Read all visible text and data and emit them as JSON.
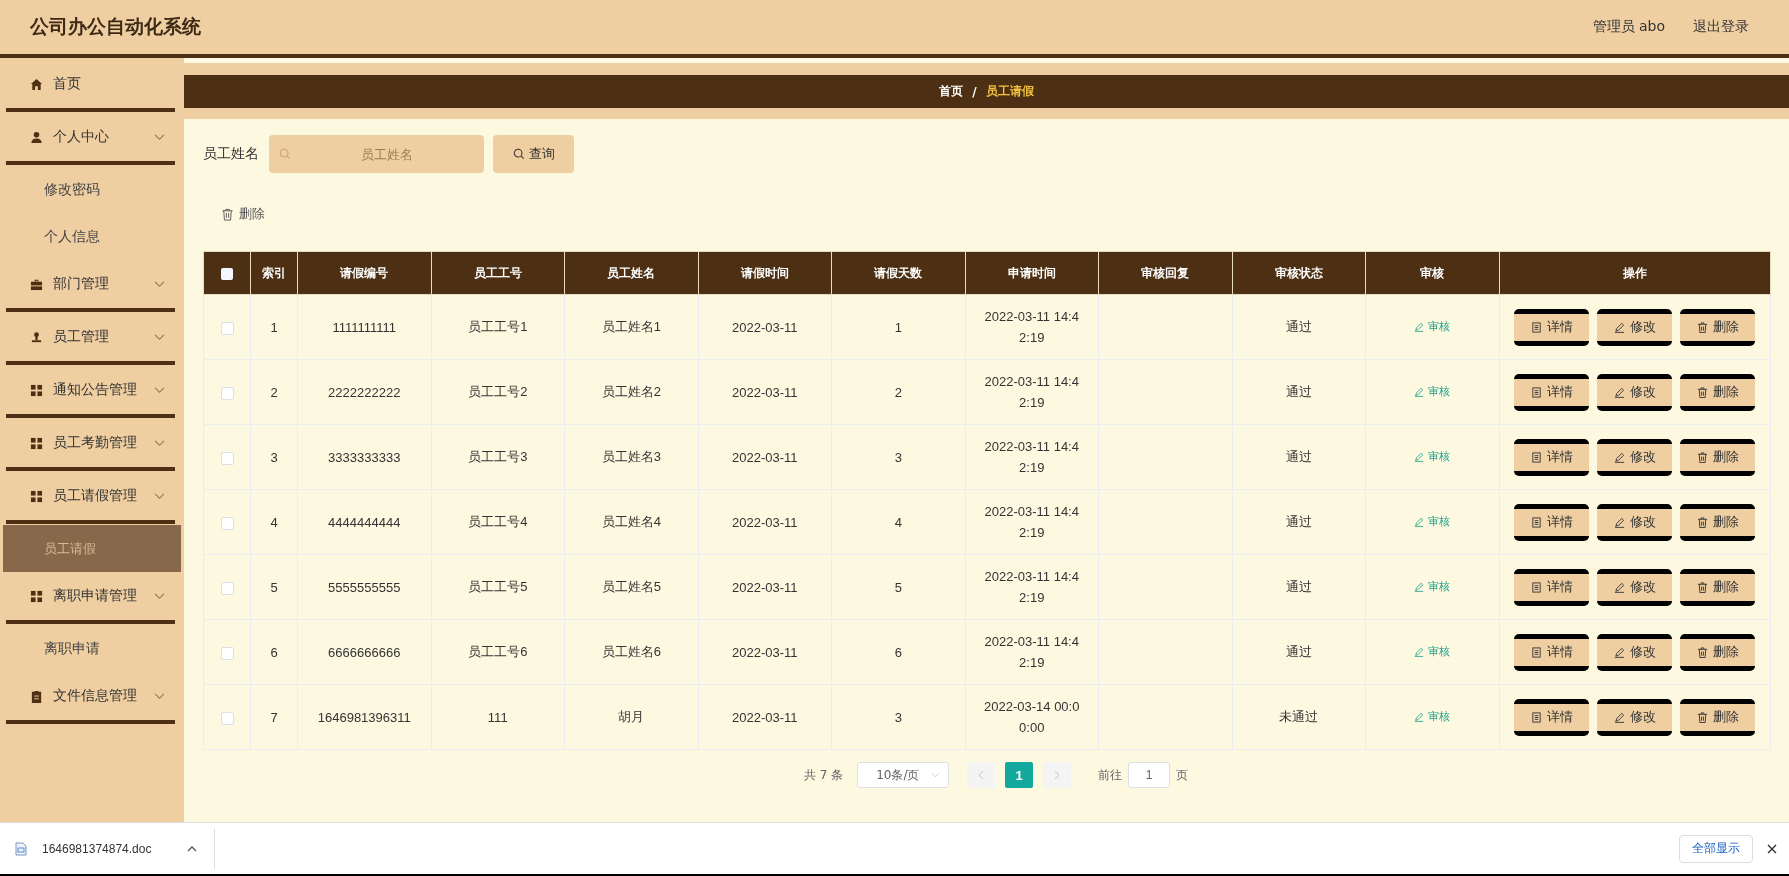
{
  "header": {
    "title": "公司办公自动化系统",
    "user": "管理员 abo",
    "logout": "退出登录"
  },
  "sidebar": {
    "items": [
      {
        "label": "首页",
        "expandable": false
      },
      {
        "label": "个人中心",
        "expandable": true,
        "children": [
          {
            "label": "修改密码",
            "selected": false
          },
          {
            "label": "个人信息",
            "selected": false
          }
        ]
      },
      {
        "label": "部门管理",
        "expandable": true
      },
      {
        "label": "员工管理",
        "expandable": true
      },
      {
        "label": "通知公告管理",
        "expandable": true
      },
      {
        "label": "员工考勤管理",
        "expandable": true
      },
      {
        "label": "员工请假管理",
        "expandable": true,
        "children": [
          {
            "label": "员工请假",
            "selected": true
          }
        ]
      },
      {
        "label": "离职申请管理",
        "expandable": true,
        "children": [
          {
            "label": "离职申请",
            "selected": false
          }
        ]
      },
      {
        "label": "文件信息管理",
        "expandable": true
      }
    ]
  },
  "breadcrumb": {
    "home": "首页",
    "separator": "/",
    "current": "员工请假"
  },
  "search": {
    "label": "员工姓名",
    "placeholder": "员工姓名",
    "button": "查询"
  },
  "delete_button": "删除",
  "table": {
    "select_all": {
      "checked": false
    },
    "columns": [
      "索引",
      "请假编号",
      "员工工号",
      "员工姓名",
      "请假时间",
      "请假天数",
      "申请时间",
      "审核回复",
      "审核状态",
      "审核",
      "操作"
    ],
    "rows": [
      {
        "checked": false,
        "index": "1",
        "leave_no": "1111111111",
        "staff_no": "员工工号1",
        "name": "员工姓名1",
        "leave_date": "2022-03-11",
        "days": "1",
        "apply_time": "2022-03-11 14:42:19",
        "reply": "",
        "status": "通过",
        "review": "审核",
        "actions": [
          "详情",
          "修改",
          "删除"
        ]
      },
      {
        "checked": false,
        "index": "2",
        "leave_no": "2222222222",
        "staff_no": "员工工号2",
        "name": "员工姓名2",
        "leave_date": "2022-03-11",
        "days": "2",
        "apply_time": "2022-03-11 14:42:19",
        "reply": "",
        "status": "通过",
        "review": "审核",
        "actions": [
          "详情",
          "修改",
          "删除"
        ]
      },
      {
        "checked": false,
        "index": "3",
        "leave_no": "3333333333",
        "staff_no": "员工工号3",
        "name": "员工姓名3",
        "leave_date": "2022-03-11",
        "days": "3",
        "apply_time": "2022-03-11 14:42:19",
        "reply": "",
        "status": "通过",
        "review": "审核",
        "actions": [
          "详情",
          "修改",
          "删除"
        ]
      },
      {
        "checked": false,
        "index": "4",
        "leave_no": "4444444444",
        "staff_no": "员工工号4",
        "name": "员工姓名4",
        "leave_date": "2022-03-11",
        "days": "4",
        "apply_time": "2022-03-11 14:42:19",
        "reply": "",
        "status": "通过",
        "review": "审核",
        "actions": [
          "详情",
          "修改",
          "删除"
        ]
      },
      {
        "checked": false,
        "index": "5",
        "leave_no": "5555555555",
        "staff_no": "员工工号5",
        "name": "员工姓名5",
        "leave_date": "2022-03-11",
        "days": "5",
        "apply_time": "2022-03-11 14:42:19",
        "reply": "",
        "status": "通过",
        "review": "审核",
        "actions": [
          "详情",
          "修改",
          "删除"
        ]
      },
      {
        "checked": false,
        "index": "6",
        "leave_no": "6666666666",
        "staff_no": "员工工号6",
        "name": "员工姓名6",
        "leave_date": "2022-03-11",
        "days": "6",
        "apply_time": "2022-03-11 14:42:19",
        "reply": "",
        "status": "通过",
        "review": "审核",
        "actions": [
          "详情",
          "修改",
          "删除"
        ]
      },
      {
        "checked": false,
        "index": "7",
        "leave_no": "1646981396311",
        "staff_no": "111",
        "name": "胡月",
        "leave_date": "2022-03-11",
        "days": "3",
        "apply_time": "2022-03-14 00:00:00",
        "reply": "",
        "status": "未通过",
        "review": "审核",
        "actions": [
          "详情",
          "修改",
          "删除"
        ]
      }
    ]
  },
  "pagination": {
    "total": "共 7 条",
    "page_size": "10条/页",
    "pages": [
      {
        "label": "1",
        "selected": true
      }
    ],
    "goto_label": "前往",
    "goto_value": "1",
    "goto_unit": "页"
  },
  "download_bar": {
    "file": "1646981374874.doc",
    "show_all": "全部显示"
  }
}
